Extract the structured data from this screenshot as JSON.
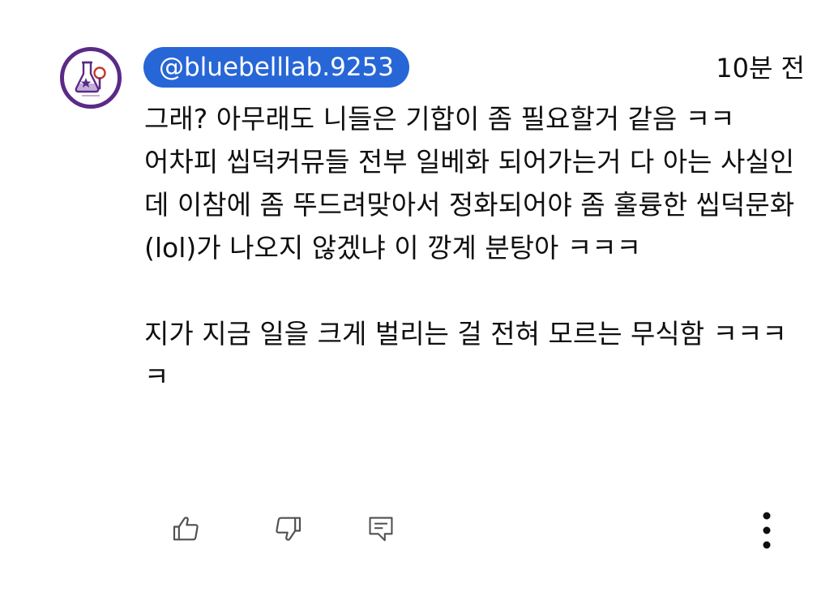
{
  "comment": {
    "author_handle": "@bluebelllab.9253",
    "timestamp": "10분 전",
    "lines": [
      "그래? 아무래도 니들은 기합이 좀 필요할거 같음 ㅋㅋ",
      "어차피 씹덕커뮤들 전부 일베화 되어가는거 다 아는 사실인데 이참에 좀 뚜드려맞아서 정화되어야 좀 훌륭한 씹덕문화(lol)가 나오지 않겠냐 이 깡계 분탕아 ㅋㅋㅋ",
      "",
      "지가 지금 일을 크게 벌리는 걸 전혀 모르는 무식함 ㅋㅋㅋㅋ"
    ]
  },
  "avatar": {
    "icon": "lab-flask-logo",
    "ring_color": "#5b2a86"
  },
  "colors": {
    "handle_bg": "#2766d6",
    "text": "#0f0f0f",
    "icon_stroke": "#505050"
  },
  "actions": {
    "like_icon": "thumbs-up-icon",
    "dislike_icon": "thumbs-down-icon",
    "reply_icon": "reply-comment-icon",
    "more_icon": "more-vertical-icon"
  }
}
